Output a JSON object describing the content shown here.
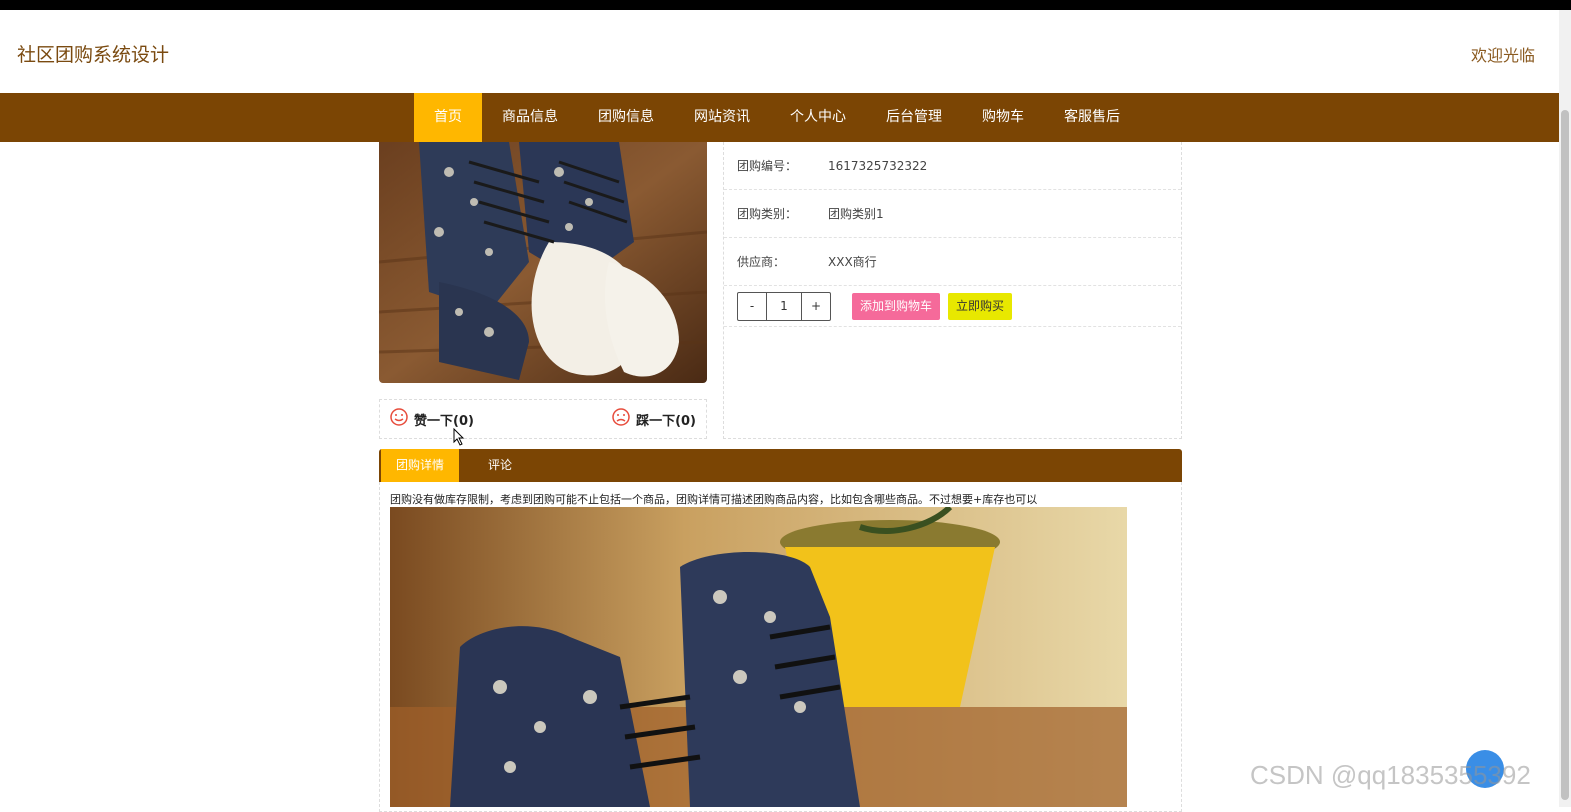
{
  "header": {
    "title": "社区团购系统设计",
    "welcome": "欢迎光临"
  },
  "nav": {
    "items": [
      {
        "label": "首页",
        "active": true
      },
      {
        "label": "商品信息"
      },
      {
        "label": "团购信息"
      },
      {
        "label": "网站资讯"
      },
      {
        "label": "个人中心"
      },
      {
        "label": "后台管理"
      },
      {
        "label": "购物车"
      },
      {
        "label": "客服售后"
      }
    ]
  },
  "product": {
    "fields": [
      {
        "key": "团购编号：",
        "value": "1617325732322"
      },
      {
        "key": "团购类别：",
        "value": "团购类别1"
      },
      {
        "key": "供应商：",
        "value": "XXX商行"
      }
    ],
    "quantity": {
      "minus": "-",
      "value": "1",
      "plus": "+"
    },
    "add_to_cart": "添加到购物车",
    "buy_now": "立即购买"
  },
  "votes": {
    "like": "赞一下(0)",
    "dislike": "踩一下(0)"
  },
  "tabs": [
    {
      "label": "团购详情",
      "active": true
    },
    {
      "label": "评论"
    }
  ],
  "detail": {
    "text": "团购没有做库存限制，考虑到团购可能不止包括一个商品，团购详情可描述团购商品内容，比如包含哪些商品。不过想要+库存也可以"
  },
  "watermark": "CSDN @qq1835355392",
  "colors": {
    "nav_bg": "#7b4504",
    "active": "#ffb700",
    "cart_btn": "#f56a9a",
    "buy_btn": "#e8e800"
  }
}
